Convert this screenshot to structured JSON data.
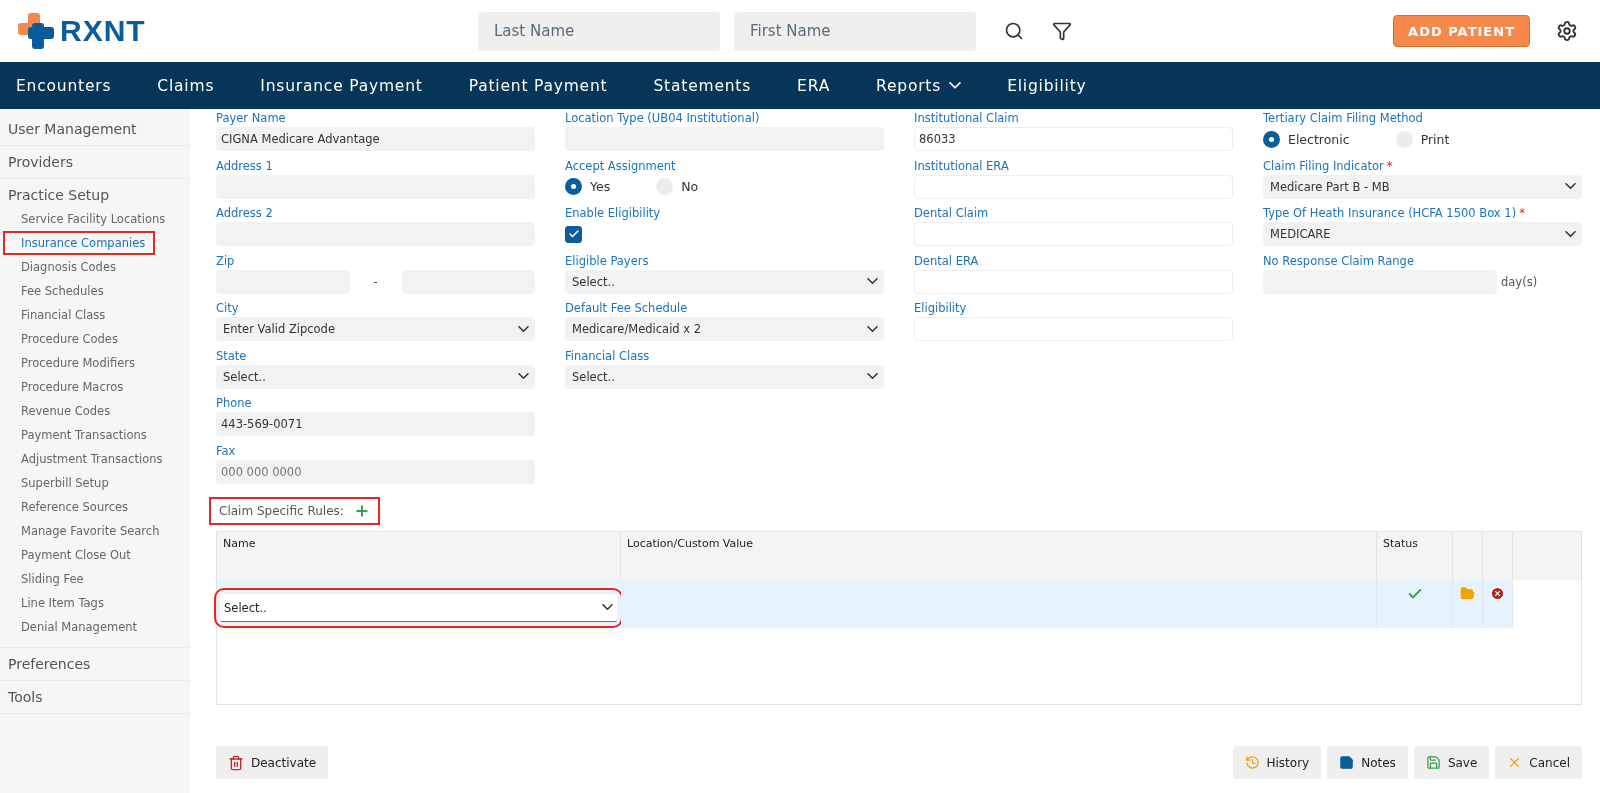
{
  "header": {
    "logo": "RXNT",
    "search_fields": [
      {
        "placeholder": "Last Name"
      },
      {
        "placeholder": "First Name"
      }
    ],
    "add_button": "ADD PATIENT"
  },
  "nav": [
    {
      "label": "Encounters",
      "kind": "link"
    },
    {
      "label": "Claims",
      "kind": "link"
    },
    {
      "label": "Insurance Payment",
      "kind": "link"
    },
    {
      "label": "Patient Payment",
      "kind": "link"
    },
    {
      "label": "Statements",
      "kind": "link"
    },
    {
      "label": "ERA",
      "kind": "link"
    },
    {
      "label": "Reports",
      "kind": "dropdown"
    },
    {
      "label": "Eligibility",
      "kind": "link"
    }
  ],
  "sidebar": {
    "groups": [
      {
        "label": "User Management"
      },
      {
        "label": "Providers"
      },
      {
        "label": "Practice Setup",
        "children": [
          {
            "label": "Service Facility Locations",
            "selected": false,
            "highlighted": false
          },
          {
            "label": "Insurance Companies",
            "selected": true,
            "highlighted": true
          },
          {
            "label": "Diagnosis Codes",
            "selected": false,
            "highlighted": false
          },
          {
            "label": "Fee Schedules",
            "selected": false,
            "highlighted": false
          },
          {
            "label": "Financial Class",
            "selected": false,
            "highlighted": false
          },
          {
            "label": "Procedure Codes",
            "selected": false,
            "highlighted": false
          },
          {
            "label": "Procedure Modifiers",
            "selected": false,
            "highlighted": false
          },
          {
            "label": "Procedure Macros",
            "selected": false,
            "highlighted": false
          },
          {
            "label": "Revenue Codes",
            "selected": false,
            "highlighted": false
          },
          {
            "label": "Payment Transactions",
            "selected": false,
            "highlighted": false
          },
          {
            "label": "Adjustment Transactions",
            "selected": false,
            "highlighted": false
          },
          {
            "label": "Superbill Setup",
            "selected": false,
            "highlighted": false
          },
          {
            "label": "Reference Sources",
            "selected": false,
            "highlighted": false
          },
          {
            "label": "Manage Favorite Search",
            "selected": false,
            "highlighted": false
          },
          {
            "label": "Payment Close Out",
            "selected": false,
            "highlighted": false
          },
          {
            "label": "Sliding Fee",
            "selected": false,
            "highlighted": false
          },
          {
            "label": "Line Item Tags",
            "selected": false,
            "highlighted": false
          },
          {
            "label": "Denial Management",
            "selected": false,
            "highlighted": false
          }
        ]
      },
      {
        "label": "Preferences"
      },
      {
        "label": "Tools"
      }
    ]
  },
  "form_columns": [
    [
      {
        "kind": "text",
        "label": "Payer Name",
        "value": "CIGNA Medicare Advantage"
      },
      {
        "kind": "text",
        "label": "Address 1"
      },
      {
        "kind": "text",
        "label": "Address 2"
      },
      {
        "kind": "zip",
        "label": "Zip",
        "separator": "-"
      },
      {
        "kind": "select",
        "label": "City",
        "value": "Enter Valid Zipcode"
      },
      {
        "kind": "select",
        "label": "State",
        "value": "Select.."
      },
      {
        "kind": "text",
        "label": "Phone",
        "value": "443-569-0071"
      },
      {
        "kind": "text",
        "label": "Fax",
        "placeholder": "000 000 0000"
      }
    ],
    [
      {
        "kind": "text",
        "label": "Location Type (UB04 Institutional)"
      },
      {
        "kind": "radio",
        "label": "Accept Assignment",
        "options": [
          {
            "label": "Yes",
            "selected": true
          },
          {
            "label": "No",
            "selected": false
          }
        ]
      },
      {
        "kind": "checkbox",
        "label": "Enable Eligibility",
        "checked": true
      },
      {
        "kind": "select",
        "label": "Eligible Payers",
        "value": "Select.."
      },
      {
        "kind": "select",
        "label": "Default Fee Schedule",
        "value": "Medicare/Medicaid x 2"
      },
      {
        "kind": "select",
        "label": "Financial Class",
        "value": "Select.."
      }
    ],
    [
      {
        "kind": "outlined",
        "label": "Institutional Claim",
        "value": "86033"
      },
      {
        "kind": "outlined",
        "label": "Institutional ERA"
      },
      {
        "kind": "outlined",
        "label": "Dental Claim"
      },
      {
        "kind": "outlined",
        "label": "Dental ERA"
      },
      {
        "kind": "outlined",
        "label": "Eligibility"
      }
    ],
    [
      {
        "kind": "radio",
        "label": "Tertiary Claim Filing Method",
        "options": [
          {
            "label": "Electronic",
            "selected": true
          },
          {
            "label": "Print",
            "selected": false
          }
        ]
      },
      {
        "kind": "select",
        "label": "Claim Filing Indicator",
        "required_mark": "*",
        "value": "Medicare Part B - MB"
      },
      {
        "kind": "select",
        "label": "Type Of Heath Insurance (HCFA 1500 Box 1)",
        "required_mark": "*",
        "value": "MEDICARE"
      },
      {
        "kind": "suffix",
        "label": "No Response Claim Range",
        "suffix": "day(s)"
      }
    ]
  ],
  "rules": {
    "title": "Claim Specific Rules:",
    "highlighted": true,
    "columns": [
      "Name",
      "Location/Custom Value",
      "Status"
    ],
    "rows": [
      {
        "name_select": "Select..",
        "highlighted": true,
        "status_ok": true
      }
    ]
  },
  "footer": {
    "left": [
      {
        "label": "Deactivate",
        "kind": "delete"
      }
    ],
    "right": [
      {
        "label": "History",
        "kind": "history"
      },
      {
        "label": "Notes",
        "kind": "notes"
      },
      {
        "label": "Save",
        "kind": "save"
      },
      {
        "label": "Cancel",
        "kind": "cancel"
      }
    ]
  }
}
